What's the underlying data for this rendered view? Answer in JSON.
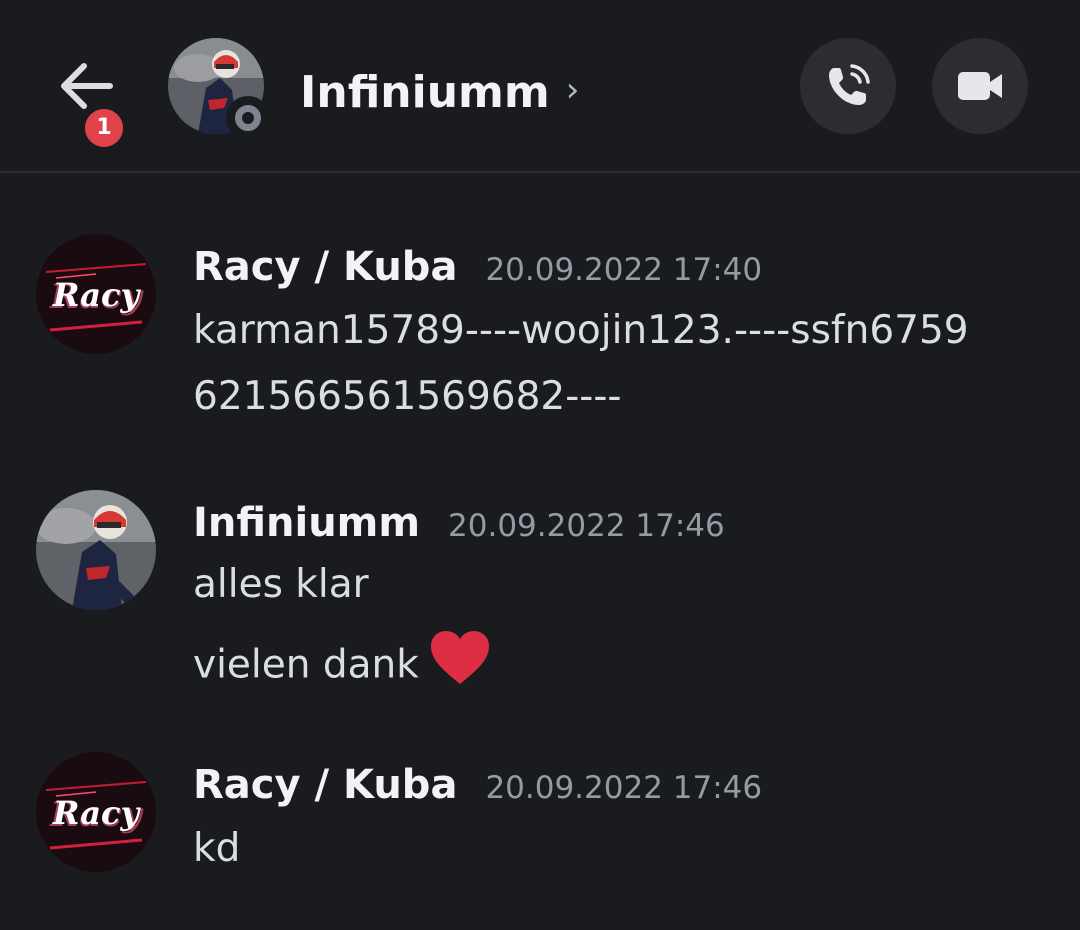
{
  "header": {
    "back_badge": "1",
    "title": "Infiniumm",
    "chevron": "›",
    "icons": {
      "back": "arrow-left-icon",
      "call": "phone-call-icon",
      "video": "video-camera-icon",
      "status": "offline-status-icon"
    }
  },
  "colors": {
    "background": "#1a1b1f",
    "badge": "#e3424a",
    "button_bg": "#2b2d31",
    "heart": "#dd2e44",
    "timestamp": "#949ba4"
  },
  "messages": [
    {
      "author": "Racy / Kuba",
      "timestamp": "20.09.2022 17:40",
      "avatar_text": "Racy",
      "lines": [
        "karman15789----woojin123.----ssfn6759",
        "621566561569682----"
      ]
    },
    {
      "author": "Infiniumm",
      "timestamp": "20.09.2022 17:46",
      "lines": [
        "alles klar",
        "vielen dank"
      ],
      "emoji": "heart-emoji"
    },
    {
      "author": "Racy / Kuba",
      "timestamp": "20.09.2022 17:46",
      "avatar_text": "Racy",
      "lines": [
        "kd"
      ]
    }
  ]
}
